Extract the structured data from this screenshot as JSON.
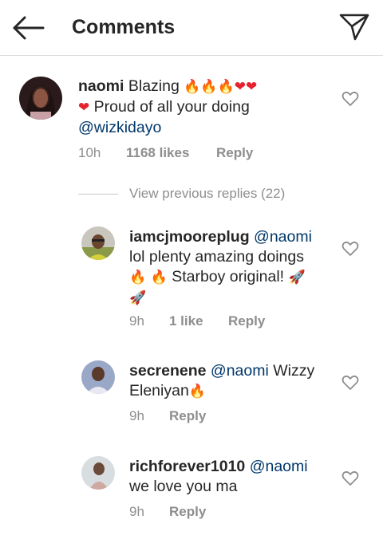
{
  "header": {
    "title": "Comments"
  },
  "main_comment": {
    "username": "naomi",
    "text1": "Blazing",
    "text2": "Proud of all your doing",
    "mention": "@wizkidayo",
    "time": "10h",
    "likes": "1168 likes",
    "reply": "Reply"
  },
  "view_previous": "View previous replies (22)",
  "replies": [
    {
      "username": "iamcjmooreplug",
      "mention": "@naomi",
      "text1": "lol plenty amazing doings",
      "text2": "Starboy original!",
      "time": "9h",
      "likes": "1 like",
      "reply": "Reply"
    },
    {
      "username": "secrenene",
      "mention": "@naomi",
      "text1": "Wizzy",
      "text2": "Eleniyan",
      "time": "9h",
      "reply": "Reply"
    },
    {
      "username": "richforever1010",
      "mention": "@naomi",
      "text1": "we love you ma",
      "time": "9h",
      "reply": "Reply"
    }
  ],
  "icons": {
    "back": "arrow-left-icon",
    "share": "paper-plane-icon",
    "like": "heart-outline-icon",
    "fire": "fire-emoji",
    "heart": "red-heart-emoji",
    "rocket": "rocket-emoji"
  },
  "colors": {
    "mention": "#00376b",
    "meta": "#8e8e8e",
    "text": "#262626"
  }
}
